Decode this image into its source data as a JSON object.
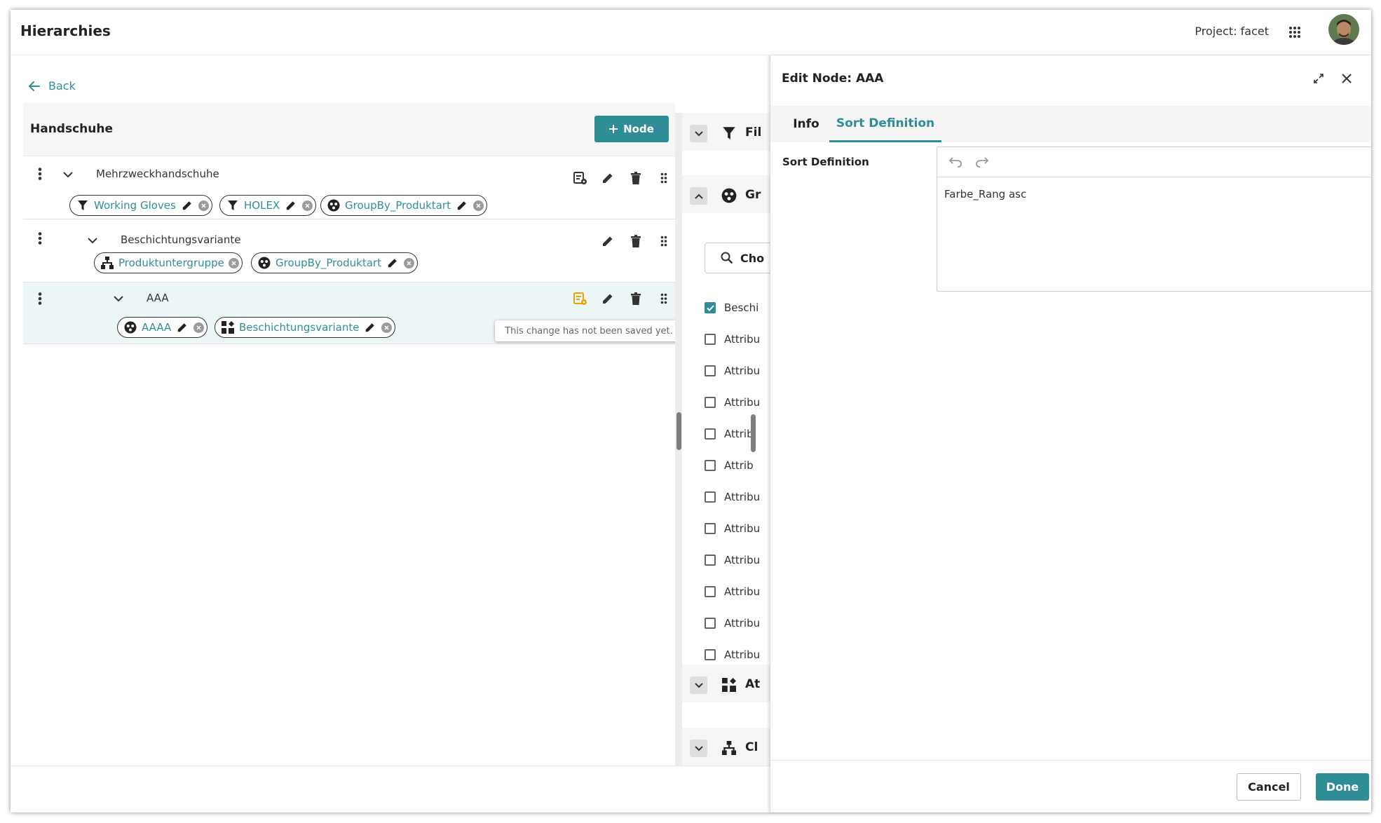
{
  "app": {
    "title": "Hierarchies",
    "project_label": "Project: facet",
    "accent_color": "#2e8d96",
    "apps_icon": "apps-grid-icon",
    "avatar": "user-avatar"
  },
  "nav": {
    "back_label": "Back"
  },
  "tree": {
    "title": "Handschuhe",
    "add_node_label": "Node",
    "nodes": [
      {
        "name": "Mehrzweckhandschuhe",
        "chips": [
          {
            "icon": "filter-icon",
            "label": "Working Gloves"
          },
          {
            "icon": "filter-icon",
            "label": "HOLEX"
          },
          {
            "icon": "group-icon",
            "label": "GroupBy_Produktart"
          }
        ]
      },
      {
        "name": "Beschichtungsvariante",
        "chips": [
          {
            "icon": "hierarchy-icon",
            "label": "Produktuntergruppe"
          },
          {
            "icon": "group-icon",
            "label": "GroupBy_Produktart"
          }
        ]
      },
      {
        "name": "AAA",
        "unsaved": true,
        "chips": [
          {
            "icon": "group-icon",
            "label": "AAAA"
          },
          {
            "icon": "attribute-icon",
            "label": "Beschichtungsvariante"
          }
        ]
      }
    ],
    "tooltip": "This change has not been saved yet."
  },
  "side_panel": {
    "sections": [
      "Fil",
      "Gr",
      "At",
      "Cl"
    ],
    "search_placeholder": "Cho",
    "items": [
      {
        "label": "Beschi",
        "checked": true
      },
      {
        "label": "Attribu",
        "checked": false
      },
      {
        "label": "Attribu",
        "checked": false
      },
      {
        "label": "Attribu",
        "checked": false
      },
      {
        "label": "Attrib",
        "checked": false
      },
      {
        "label": "Attrib",
        "checked": false
      },
      {
        "label": "Attribu",
        "checked": false
      },
      {
        "label": "Attribu",
        "checked": false
      },
      {
        "label": "Attribu",
        "checked": false
      },
      {
        "label": "Attribu",
        "checked": false
      },
      {
        "label": "Attribu",
        "checked": false
      },
      {
        "label": "Attribu",
        "checked": false
      }
    ]
  },
  "dialog": {
    "title": "Edit Node: AAA",
    "tabs": [
      {
        "label": "Info"
      },
      {
        "label": "Sort Definition",
        "active": true
      }
    ],
    "field_label": "Sort Definition",
    "editor_value": "Farbe_Rang asc",
    "cancel_label": "Cancel",
    "done_label": "Done"
  }
}
